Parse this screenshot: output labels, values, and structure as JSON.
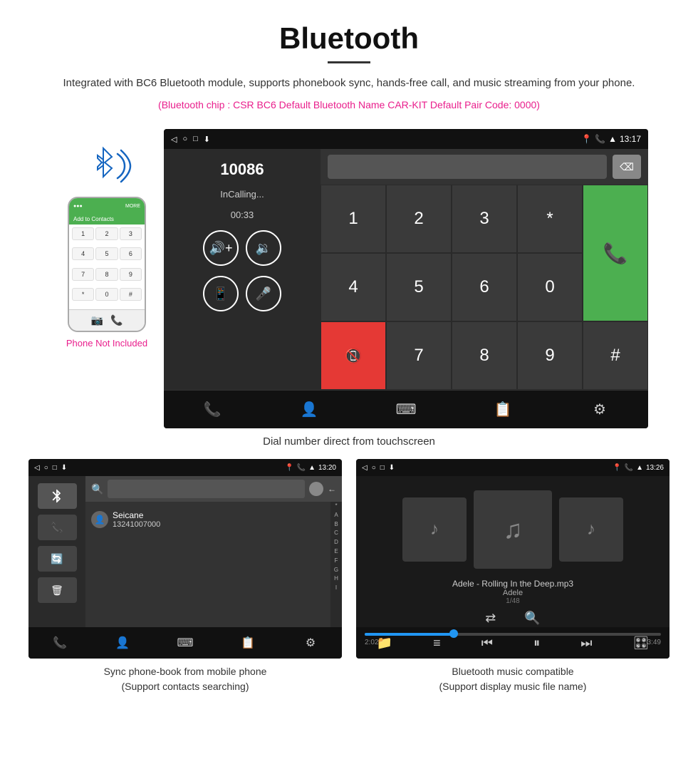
{
  "header": {
    "title": "Bluetooth",
    "description": "Integrated with BC6 Bluetooth module, supports phonebook sync, hands-free call, and music streaming from your phone.",
    "specs": "(Bluetooth chip : CSR BC6    Default Bluetooth Name CAR-KIT    Default Pair Code: 0000)"
  },
  "main_screen": {
    "status_bar": {
      "left_icons": [
        "back-arrow",
        "circle",
        "square",
        "download"
      ],
      "right_time": "13:17",
      "right_icons": [
        "location-pin",
        "phone",
        "wifi-signal"
      ]
    },
    "call_panel": {
      "number": "10086",
      "status": "InCalling...",
      "timer": "00:33"
    },
    "numpad": {
      "keys": [
        "1",
        "2",
        "3",
        "*",
        "4",
        "5",
        "6",
        "0",
        "7",
        "8",
        "9",
        "#"
      ]
    },
    "caption": "Dial number direct from touchscreen"
  },
  "bottom_left": {
    "status_bar": {
      "time": "13:20",
      "icons": [
        "location-pin",
        "phone",
        "wifi"
      ]
    },
    "contact": {
      "name": "Seicane",
      "number": "13241007000"
    },
    "alphabet": [
      "A",
      "B",
      "C",
      "D",
      "E",
      "F",
      "G",
      "H",
      "I"
    ],
    "caption_line1": "Sync phone-book from mobile phone",
    "caption_line2": "(Support contacts searching)"
  },
  "bottom_right": {
    "status_bar": {
      "time": "13:26",
      "icons": [
        "location-pin",
        "phone",
        "wifi"
      ]
    },
    "music": {
      "title": "Adele - Rolling In the Deep.mp3",
      "artist": "Adele",
      "track": "1/48",
      "time_current": "2:02",
      "time_total": "3:49",
      "progress_percent": 30
    },
    "caption_line1": "Bluetooth music compatible",
    "caption_line2": "(Support display music file name)"
  },
  "phone_side": {
    "not_included": "Phone Not Included"
  }
}
